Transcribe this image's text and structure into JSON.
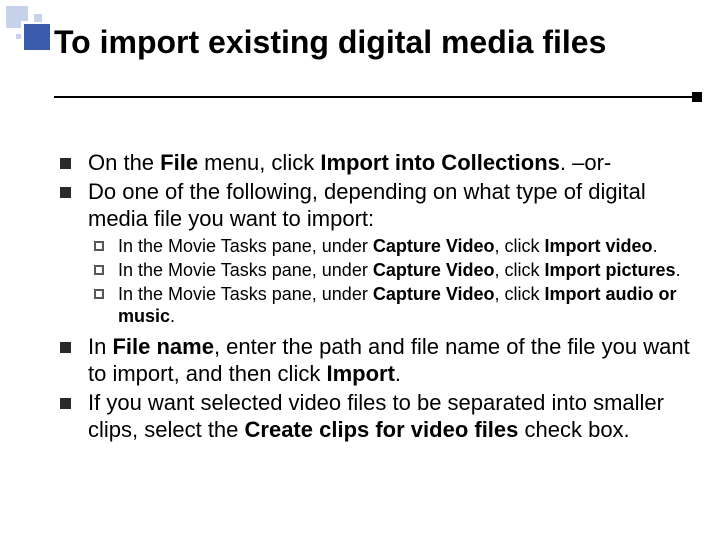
{
  "title": "To import existing digital media files",
  "bullets": {
    "b1": {
      "pre": "On the ",
      "bold1": "File",
      "mid1": " menu, click ",
      "bold2": "Import into Collections",
      "post": ". –or‑"
    },
    "b2": "Do one of the following, depending on what type of digital media file you want to import:",
    "sub": {
      "s1": {
        "pre": "In the Movie Tasks pane, under ",
        "bold1": "Capture Video",
        "mid": ", click ",
        "bold2": "Import video",
        "post": "."
      },
      "s2": {
        "pre": "In the Movie Tasks pane, under ",
        "bold1": "Capture Video",
        "mid": ", click ",
        "bold2": "Import pictures",
        "post": "."
      },
      "s3": {
        "pre": "In the Movie Tasks pane, under ",
        "bold1": "Capture Video",
        "mid": ", click ",
        "bold2": "Import audio or music",
        "post": "."
      }
    },
    "b3": {
      "pre": "In ",
      "bold1": "File name",
      "mid": ", enter the path and file name of the file you want to import, and then click ",
      "bold2": "Import",
      "post": "."
    },
    "b4": {
      "pre": "If you want selected video files to be separated into smaller clips, select the ",
      "bold1": "Create clips for video files",
      "post": " check box."
    }
  }
}
